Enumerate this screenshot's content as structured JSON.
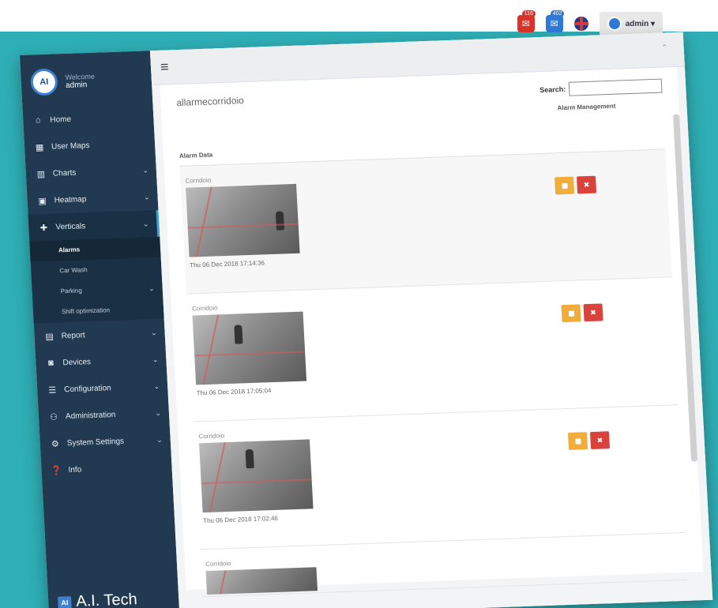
{
  "topbar": {
    "alerts_badge": "116",
    "messages_badge": "402",
    "user_label": "admin ▾"
  },
  "sidebar": {
    "welcome": "Welcome",
    "username": "admin",
    "items": [
      {
        "label": "Home",
        "icon": "home-icon"
      },
      {
        "label": "User Maps",
        "icon": "map-icon"
      },
      {
        "label": "Charts",
        "icon": "chart-icon"
      },
      {
        "label": "Heatmap",
        "icon": "image-icon"
      },
      {
        "label": "Verticals",
        "icon": "puzzle-icon"
      }
    ],
    "sub_items": [
      {
        "label": "Alarms"
      },
      {
        "label": "Car Wash"
      },
      {
        "label": "Parking"
      },
      {
        "label": "Shift optimization"
      }
    ],
    "items_after": [
      {
        "label": "Report",
        "icon": "file-icon"
      },
      {
        "label": "Devices",
        "icon": "camera-icon"
      },
      {
        "label": "Configuration",
        "icon": "sliders-icon"
      },
      {
        "label": "Administration",
        "icon": "users-icon"
      },
      {
        "label": "System Settings",
        "icon": "gears-icon"
      },
      {
        "label": "Info",
        "icon": "info-icon"
      }
    ],
    "brand": "A.I. Tech",
    "brand_logo": "AI"
  },
  "main": {
    "title": "allarmecorridoio",
    "search_label": "Search:",
    "col_data": "Alarm Data",
    "col_mgmt": "Alarm Management",
    "rows": [
      {
        "camera": "Corridoio",
        "time": "Thu 06 Dec 2018 17:14:36"
      },
      {
        "camera": "Corridoio",
        "time": "Thu 06 Dec 2018 17:05:04"
      },
      {
        "camera": "Corridoio",
        "time": "Thu 06 Dec 2018 17:02:46"
      },
      {
        "camera": "Corridoio",
        "time": ""
      }
    ]
  }
}
